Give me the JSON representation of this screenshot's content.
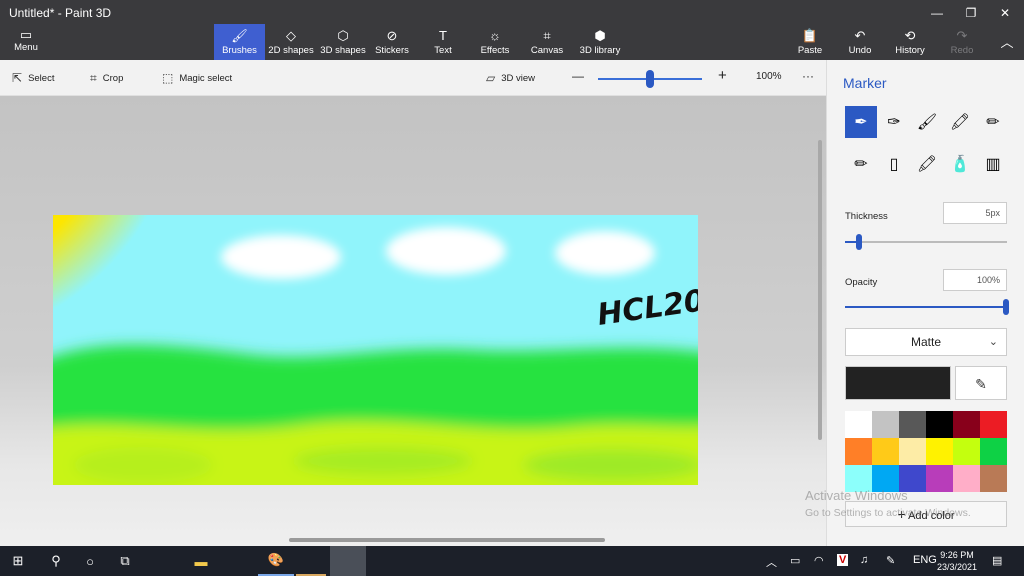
{
  "window": {
    "title": "Untitled* - Paint 3D",
    "minimize": "—",
    "maximize": "❐",
    "close": "✕"
  },
  "ribbon": {
    "menu_label": "Menu",
    "tabs": [
      {
        "label": "Brushes",
        "icon": "brush-icon",
        "glyph": "🖌"
      },
      {
        "label": "2D shapes",
        "icon": "2d-shapes-icon",
        "glyph": "◇"
      },
      {
        "label": "3D shapes",
        "icon": "3d-shapes-icon",
        "glyph": "⬡"
      },
      {
        "label": "Stickers",
        "icon": "stickers-icon",
        "glyph": "⊘"
      },
      {
        "label": "Text",
        "icon": "text-icon",
        "glyph": "T"
      },
      {
        "label": "Effects",
        "icon": "effects-icon",
        "glyph": "☼"
      },
      {
        "label": "Canvas",
        "icon": "canvas-icon",
        "glyph": "⌗"
      },
      {
        "label": "3D library",
        "icon": "3d-library-icon",
        "glyph": "⬢"
      }
    ],
    "right": [
      {
        "label": "Paste",
        "icon": "paste-icon",
        "glyph": "📋"
      },
      {
        "label": "Undo",
        "icon": "undo-icon",
        "glyph": "↶"
      },
      {
        "label": "History",
        "icon": "history-icon",
        "glyph": "⟲"
      },
      {
        "label": "Redo",
        "icon": "redo-icon",
        "glyph": "↷"
      }
    ],
    "collapse": "︿"
  },
  "toolbar": {
    "select": "Select",
    "crop": "Crop",
    "magic_select": "Magic select",
    "view_3d": "3D view",
    "zoom_out": "—",
    "zoom_in": "+",
    "zoom": "100%",
    "more": "···",
    "zoom_value": 0.5
  },
  "canvas": {
    "signature": "HCL20"
  },
  "panel": {
    "title": "Marker",
    "brushes": [
      {
        "name": "marker-brush-icon",
        "glyph": "✒"
      },
      {
        "name": "calligraphy-pen-icon",
        "glyph": "✑"
      },
      {
        "name": "oil-brush-icon",
        "glyph": "🖌"
      },
      {
        "name": "watercolor-icon",
        "glyph": "🖍"
      },
      {
        "name": "pixel-pen-icon",
        "glyph": "✏"
      },
      {
        "name": "pencil-icon",
        "glyph": "✏"
      },
      {
        "name": "eraser-icon",
        "glyph": "▯"
      },
      {
        "name": "crayon-icon",
        "glyph": "🖍"
      },
      {
        "name": "spray-can-icon",
        "glyph": "🧴"
      },
      {
        "name": "fill-bucket-icon",
        "glyph": "▥"
      }
    ],
    "thickness_label": "Thickness",
    "thickness_value": "5px",
    "thickness_level": 0.05,
    "opacity_label": "Opacity",
    "opacity_value": "100%",
    "opacity_level": 1.0,
    "finish": "Matte",
    "finish_chevron": "⌄",
    "eyedropper": "✎",
    "current_color": "#222222",
    "palette": [
      "#ffffff",
      "#c3c3c3",
      "#585858",
      "#000000",
      "#88001b",
      "#ec1c24",
      "#ff7f27",
      "#ffca18",
      "#fdeca6",
      "#fff200",
      "#c4ff0e",
      "#0ed145",
      "#8cfffb",
      "#00a8f3",
      "#3f48cc",
      "#b83dba",
      "#ffaec8",
      "#b97a56"
    ],
    "add_color": "Add color",
    "add_plus": "+"
  },
  "watermark": {
    "line1": "Activate Windows",
    "line2": "Go to Settings to activate Windows."
  },
  "taskbar": {
    "time": "9:26 PM",
    "date": "23/3/2021",
    "lang": "ENG"
  }
}
